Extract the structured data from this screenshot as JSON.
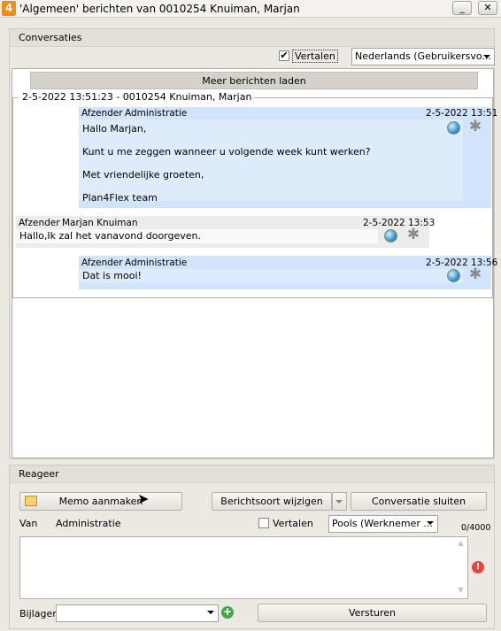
{
  "window": {
    "title": "'Algemeen' berichten van 0010254 Knuiman, Marjan",
    "app_icon_label": "4",
    "minimize": "_",
    "maximize": "□",
    "close": "✕"
  },
  "conversations": {
    "header": "Conversaties",
    "translate_label": "Vertalen",
    "translate_checked": true,
    "language": "Nederlands (Gebruikersvo...",
    "load_more": "Meer berichten laden",
    "thread_title": "2-5-2022 13:51:23 - 0010254 Knuiman, Marjan",
    "messages": [
      {
        "sender_label": "Afzender",
        "sender": "Administratie",
        "time": "2-5-2022 13:51",
        "lines": [
          "Hallo Marjan,",
          "Kunt u me zeggen wanneer u volgende week kunt werken?",
          "Met vriendelijke groeten,",
          "Plan4Flex team"
        ]
      },
      {
        "sender_label": "Afzender",
        "sender": "Marjan Knuiman",
        "time": "2-5-2022 13:53",
        "lines": [
          "Hallo,Ik zal het vanavond doorgeven."
        ]
      },
      {
        "sender_label": "Afzender",
        "sender": "Administratie",
        "time": "2-5-2022 13:56",
        "lines": [
          "Dat is mooi!"
        ]
      }
    ]
  },
  "reply": {
    "header": "Reageer",
    "memo_button": "Memo aanmaken",
    "type_button": "Berichtsoort wijzigen",
    "close_button": "Conversatie sluiten",
    "from_label": "Van",
    "from_value": "Administratie",
    "translate_label": "Vertalen",
    "translate_checked": false,
    "language": "Pools (Werknemer ...",
    "counter": "0/4000",
    "message_value": "",
    "attachments_label": "Bijlagen",
    "attachments_value": "",
    "send_button": "Versturen"
  },
  "colors": {
    "admin_header": "#d2e4fb",
    "admin_body": "#ddebfb",
    "user_header": "#ececec",
    "window_bg": "#ece9e3"
  }
}
